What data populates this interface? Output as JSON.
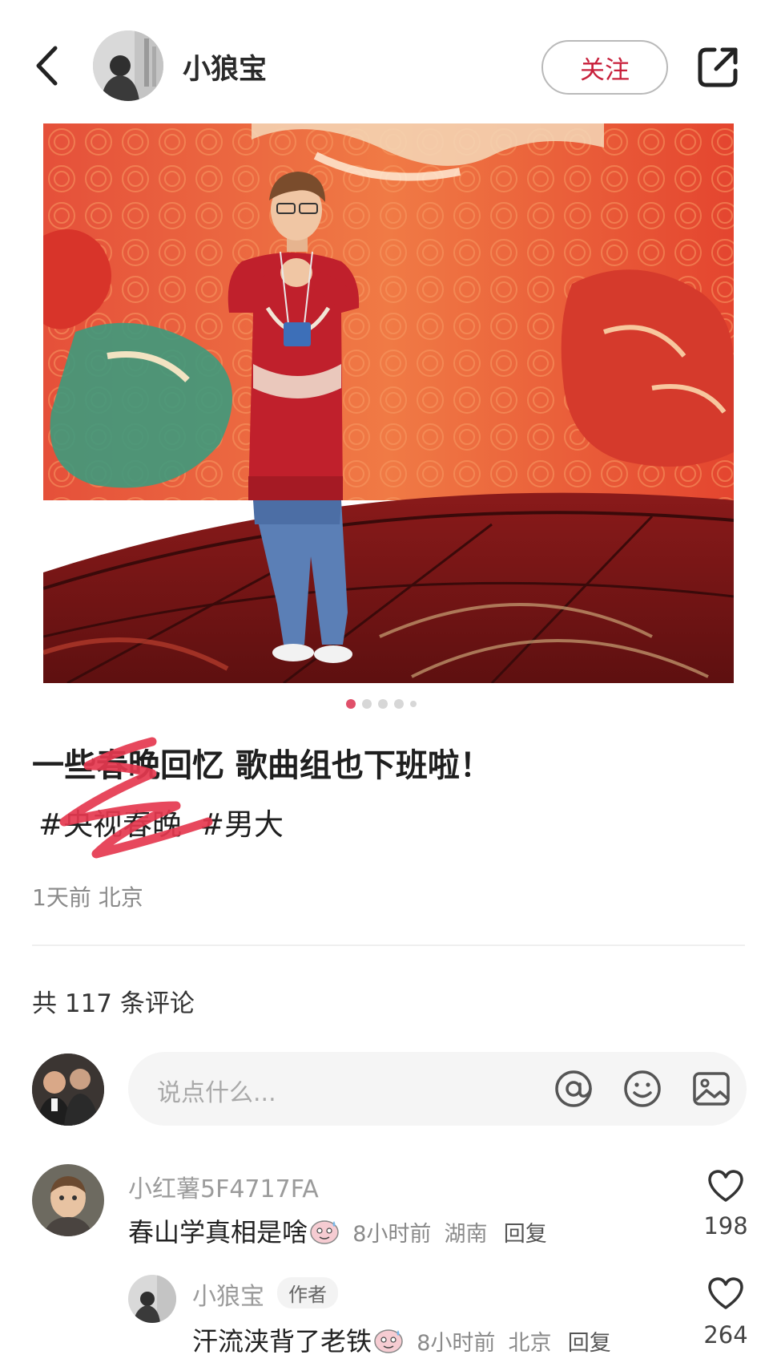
{
  "header": {
    "author_name": "小狼宝",
    "follow_label": "关注"
  },
  "carousel": {
    "page_count": 5,
    "current_page": 1
  },
  "post": {
    "title": "一些春晚回忆 歌曲组也下班啦！",
    "tags": [
      "#央视春晚",
      "#男大"
    ],
    "meta": "1天前 北京"
  },
  "comments_section": {
    "count_text": "共 117 条评论",
    "input_placeholder": "说点什么..."
  },
  "comments": [
    {
      "name": "小红薯5F4717FA",
      "text": "春山学真相是啥",
      "time": "8小时前",
      "location": "湖南",
      "reply_label": "回复",
      "likes": "198"
    },
    {
      "name": "小狼宝",
      "badge": "作者",
      "text": "汗流浃背了老铁",
      "time": "8小时前",
      "location": "北京",
      "reply_label": "回复",
      "likes": "264"
    }
  ],
  "colors": {
    "accent": "#c8203b",
    "dot_active": "#e0506a",
    "scribble": "#e5384f"
  },
  "icons": [
    "back-arrow-icon",
    "share-icon",
    "at-icon",
    "emoji-icon",
    "image-icon",
    "heart-icon"
  ]
}
